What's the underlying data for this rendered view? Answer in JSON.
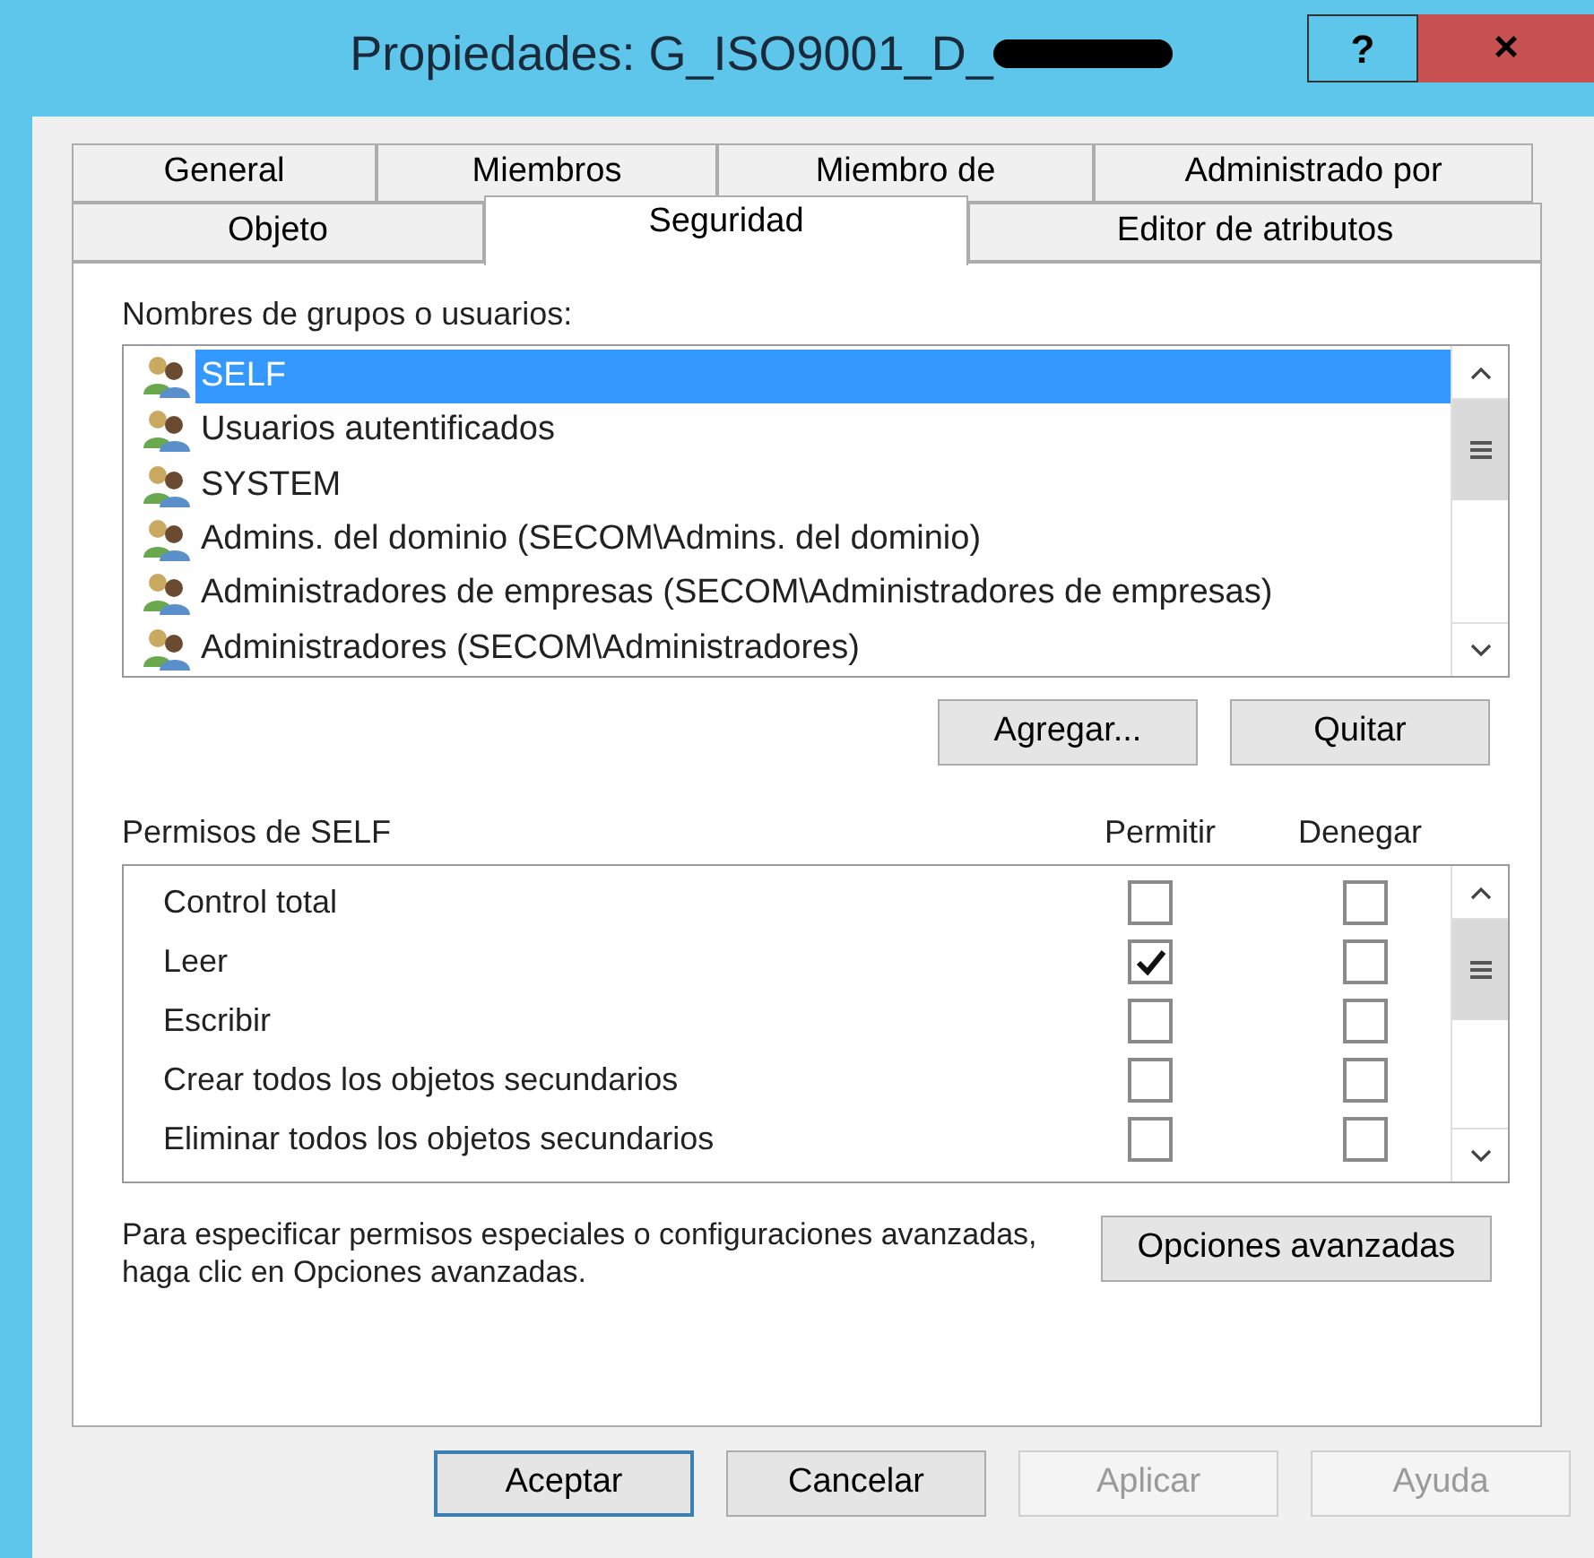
{
  "window": {
    "title": "Propiedades: G_ISO9001_D_",
    "help": "?",
    "close": "×"
  },
  "tab_rows": [
    [
      {
        "label": "General",
        "selected": false
      },
      {
        "label": "Miembros",
        "selected": false
      },
      {
        "label": "Miembro de",
        "selected": false
      },
      {
        "label": "Administrado por",
        "selected": false
      }
    ],
    [
      {
        "label": "Objeto",
        "selected": false
      },
      {
        "label": "Seguridad",
        "selected": true
      },
      {
        "label": "Editor de atributos",
        "selected": false
      }
    ]
  ],
  "principals": {
    "label": "Nombres de grupos o usuarios:",
    "items": [
      {
        "name": "SELF",
        "selected": true
      },
      {
        "name": "Usuarios autentificados",
        "selected": false
      },
      {
        "name": "SYSTEM",
        "selected": false
      },
      {
        "name": "Admins. del dominio (SECOM\\Admins. del dominio)",
        "selected": false
      },
      {
        "name": "Administradores de empresas (SECOM\\Administradores de empresas)",
        "selected": false
      },
      {
        "name": "Administradores (SECOM\\Administradores)",
        "selected": false
      }
    ]
  },
  "principal_buttons": [
    "Agregar...",
    "Quitar"
  ],
  "permissions": {
    "label": "Permisos de SELF",
    "allow_header": "Permitir",
    "deny_header": "Denegar",
    "rows": [
      {
        "name": "Control total",
        "allow": false,
        "deny": false
      },
      {
        "name": "Leer",
        "allow": true,
        "deny": false
      },
      {
        "name": "Escribir",
        "allow": false,
        "deny": false
      },
      {
        "name": "Crear todos los objetos secundarios",
        "allow": false,
        "deny": false
      },
      {
        "name": "Eliminar todos los objetos secundarios",
        "allow": false,
        "deny": false
      }
    ]
  },
  "advanced": {
    "text": "Para especificar permisos especiales o configuraciones avanzadas, haga clic en Opciones avanzadas.",
    "button": "Opciones avanzadas"
  },
  "buttons": [
    {
      "label": "Aceptar",
      "default": true,
      "disabled": false
    },
    {
      "label": "Cancelar",
      "default": false,
      "disabled": false
    },
    {
      "label": "Aplicar",
      "default": false,
      "disabled": true
    },
    {
      "label": "Ayuda",
      "default": false,
      "disabled": true
    }
  ]
}
